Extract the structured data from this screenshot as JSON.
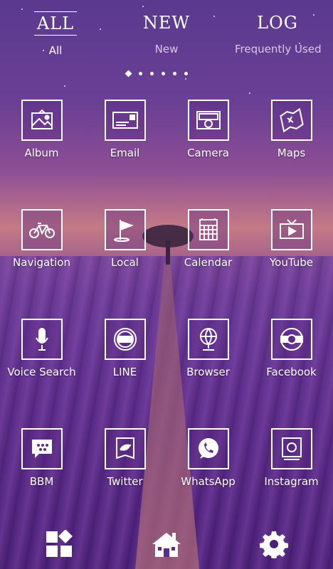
{
  "tabs": [
    {
      "big": "ALL",
      "small": "All",
      "active": true
    },
    {
      "big": "NEW",
      "small": "New",
      "active": false
    },
    {
      "big": "LOG",
      "small": "Frequently Used",
      "active": false
    }
  ],
  "apps": [
    {
      "label": "Album",
      "icon": "album-icon"
    },
    {
      "label": "Email",
      "icon": "email-icon"
    },
    {
      "label": "Camera",
      "icon": "camera-icon"
    },
    {
      "label": "Maps",
      "icon": "maps-icon"
    },
    {
      "label": "Navigation",
      "icon": "bicycle-icon"
    },
    {
      "label": "Local",
      "icon": "flag-icon"
    },
    {
      "label": "Calendar",
      "icon": "calendar-icon"
    },
    {
      "label": "YouTube",
      "icon": "tv-icon"
    },
    {
      "label": "Voice Search",
      "icon": "microphone-icon"
    },
    {
      "label": "LINE",
      "icon": "line-icon"
    },
    {
      "label": "Browser",
      "icon": "globe-icon"
    },
    {
      "label": "Facebook",
      "icon": "facebook-icon"
    },
    {
      "label": "BBM",
      "icon": "bbm-icon"
    },
    {
      "label": "Twitter",
      "icon": "twitter-icon"
    },
    {
      "label": "WhatsApp",
      "icon": "whatsapp-icon"
    },
    {
      "label": "Instagram",
      "icon": "instagram-icon"
    }
  ],
  "dock": [
    "widgets-icon",
    "home-icon",
    "settings-icon"
  ],
  "colors": {
    "accent": "#ffffff",
    "background": "#5a2d88"
  }
}
